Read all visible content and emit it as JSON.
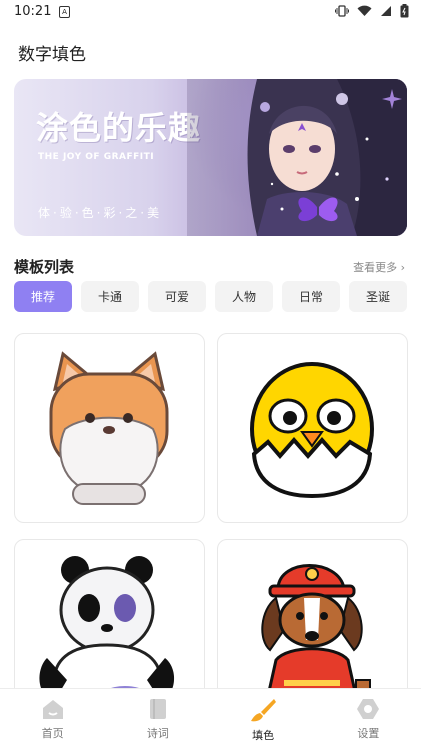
{
  "status": {
    "time": "10:21",
    "sim": "A"
  },
  "header": {
    "title": "数字填色"
  },
  "banner": {
    "title": "涂色的乐趣",
    "subtitle": "THE JOY OF GRAFFITI",
    "motto": "体·验·色·彩·之·美"
  },
  "templates": {
    "section_title": "模板列表",
    "more_label": "查看更多",
    "tabs": [
      {
        "label": "推荐",
        "active": true
      },
      {
        "label": "卡通",
        "active": false
      },
      {
        "label": "可爱",
        "active": false
      },
      {
        "label": "人物",
        "active": false
      },
      {
        "label": "日常",
        "active": false
      },
      {
        "label": "圣诞",
        "active": false
      }
    ]
  },
  "nav": {
    "items": [
      {
        "label": "首页",
        "icon": "home-icon"
      },
      {
        "label": "诗词",
        "icon": "book-icon"
      },
      {
        "label": "填色",
        "icon": "paintbrush-icon",
        "active": true
      },
      {
        "label": "设置",
        "icon": "settings-icon"
      }
    ]
  },
  "colors": {
    "accent": "#8f80f2",
    "brush": "#f5a623",
    "nav_inactive": "#cfcfcf"
  }
}
